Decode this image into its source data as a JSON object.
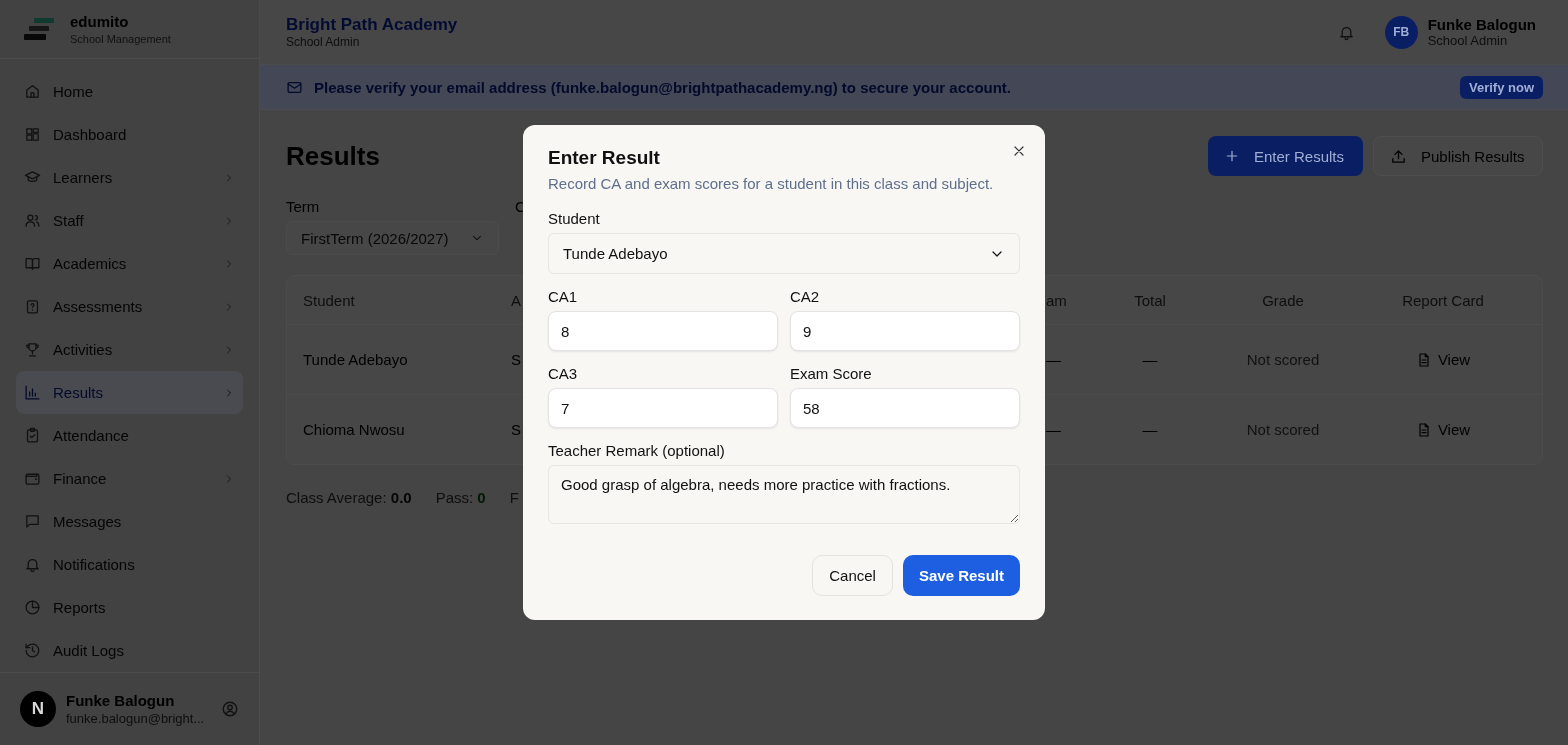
{
  "sidebar": {
    "brand": {
      "name": "edumito",
      "tagline": "School Management"
    },
    "items": [
      {
        "label": "Home",
        "expandable": false,
        "selected": false
      },
      {
        "label": "Dashboard",
        "expandable": false,
        "selected": false
      },
      {
        "label": "Learners",
        "expandable": true,
        "selected": false
      },
      {
        "label": "Staff",
        "expandable": true,
        "selected": false
      },
      {
        "label": "Academics",
        "expandable": true,
        "selected": false
      },
      {
        "label": "Assessments",
        "expandable": true,
        "selected": false
      },
      {
        "label": "Activities",
        "expandable": true,
        "selected": false
      },
      {
        "label": "Results",
        "expandable": true,
        "selected": true
      },
      {
        "label": "Attendance",
        "expandable": false,
        "selected": false
      },
      {
        "label": "Finance",
        "expandable": true,
        "selected": false
      },
      {
        "label": "Messages",
        "expandable": false,
        "selected": false
      },
      {
        "label": "Notifications",
        "expandable": false,
        "selected": false
      },
      {
        "label": "Reports",
        "expandable": false,
        "selected": false
      },
      {
        "label": "Audit Logs",
        "expandable": false,
        "selected": false
      }
    ],
    "user": {
      "initial": "N",
      "name": "Funke Balogun",
      "email": "funke.balogun@bright..."
    }
  },
  "header": {
    "school": "Bright Path Academy",
    "role": "School Admin",
    "user": {
      "initials": "FB",
      "name": "Funke Balogun",
      "role": "School Admin"
    }
  },
  "banner": {
    "message": "Please verify your email address (funke.balogun@brightpathacademy.ng) to secure your account.",
    "action": "Verify now"
  },
  "page": {
    "title": "Results",
    "actions": [
      {
        "label": "Enter Results",
        "kind": "primary"
      },
      {
        "label": "Publish Results",
        "kind": "secondary"
      }
    ],
    "filters": [
      {
        "label": "Term",
        "value": "FirstTerm (2026/2027)"
      },
      {
        "label": "C"
      }
    ],
    "table": {
      "columns": [
        "Student",
        "A",
        "am",
        "Total",
        "Grade",
        "Report Card"
      ],
      "rows": [
        {
          "cells": [
            "Tunde Adebayo",
            "S",
            "—",
            "—",
            "Not scored",
            "View"
          ]
        },
        {
          "cells": [
            "Chioma Nwosu",
            "S",
            "—",
            "—",
            "Not scored",
            "View"
          ]
        }
      ]
    },
    "stats": [
      {
        "label": "Class Average:",
        "value": "0.0",
        "color": "#050505"
      },
      {
        "label": "Pass:",
        "value": "0",
        "color": "#001a06"
      },
      {
        "label": "F"
      }
    ]
  },
  "modal": {
    "title": "Enter Result",
    "subtitle": "Record CA and exam scores for a student in this class and subject.",
    "fields": [
      {
        "label": "Student",
        "kind": "select",
        "value": "Tunde Adebayo"
      },
      {
        "label": "CA1",
        "kind": "number",
        "value": "8"
      },
      {
        "label": "CA2",
        "kind": "number",
        "value": "9"
      },
      {
        "label": "CA3",
        "kind": "number",
        "value": "7"
      },
      {
        "label": "Exam Score",
        "kind": "number",
        "value": "58"
      },
      {
        "label": "Teacher Remark (optional)",
        "kind": "textarea",
        "value": "Good grasp of algebra, needs more practice with fractions."
      }
    ],
    "buttons": [
      {
        "label": "Cancel",
        "kind": "secondary"
      },
      {
        "label": "Save Result",
        "kind": "primary"
      }
    ]
  }
}
